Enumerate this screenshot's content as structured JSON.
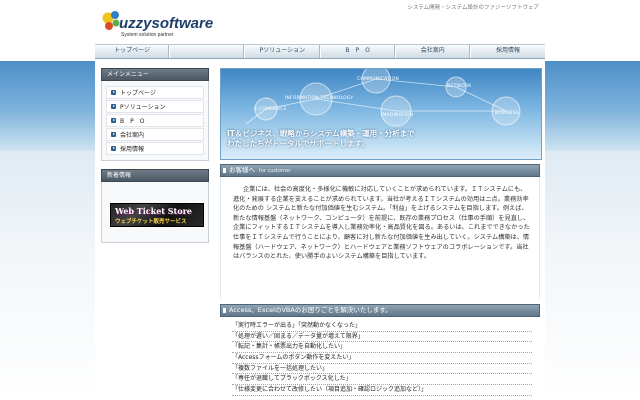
{
  "header": {
    "logo_text": "fuzzysoftware",
    "logo_sub": "System solution partner",
    "tagline": "システム開発・システム設計のファジーソフトウェア"
  },
  "nav": {
    "items": [
      {
        "label": "トップページ"
      },
      {
        "label": ""
      },
      {
        "label": "Pソリューション"
      },
      {
        "label": "B　P　O"
      },
      {
        "label": "会社案内"
      },
      {
        "label": "採用情報"
      }
    ]
  },
  "sidebar": {
    "menu_title": "メインメニュー",
    "menu_items": [
      {
        "label": "トップページ"
      },
      {
        "label": "Pソリューション"
      },
      {
        "label": "B　P　O"
      },
      {
        "label": "会社案内"
      },
      {
        "label": "採用情報"
      }
    ],
    "news_title": "新着情報",
    "banner_title": "Web Ticket Store",
    "banner_sub": "ウェブチケット販売サービス"
  },
  "hero": {
    "bubbles": [
      "COMMUNICATION",
      "INFORMATION TECHNOLOGY",
      "NETWORK",
      "E-COMMERCE",
      "IMAGINATION",
      "BUSINESS"
    ],
    "line1": "IT＆ビジネス、戦略からシステム構築・運用・分析まで",
    "line2": "わたしたちがトータルでサポートします。"
  },
  "customer": {
    "title": "お客様へ",
    "subtitle": "for customer",
    "body": "企業には、社会の高度化・多様化に機敏に対応していくことが求められています。ＩＴシステムにも、進化・発展する企業を支えることが求められています。当社が考えるＩＴシステムの効用はニ点。業務効率化のための システムと新たな付加価値を生むシステム。「利益」を上げるシステムを目指します。例えば、新たな情報基盤（ネットワーク、コンピュータ）を前提に、既存の業務プロセス（仕事の手順）を見直し、企業にフィットするＩＴシステムを導入し業務効率化・高品質化を図る。あるいは、これまでできなかった仕事をＩＴシステムで行うことにより、顧客に対し新たな付加価値を生み出していく。システム構築は、情報基盤（ハードウェア、ネットワーク）とハードウェアと業務ソフトウェアのコラボレーションです。当社はバランスのとれた、使い勝手のよいシステム構築を目指しています。"
  },
  "access": {
    "title": "Access、ExcelのVBAのお困りごとを解決いたします。",
    "items": [
      "「実行時エラーが出る」「突然動かなくなった」",
      "「処理が遅い／固まる／データ量が増えて限界」",
      "「転記・集計・帳票出力を自動化したい」",
      "「Accessフォームのボタン動作を変えたい」",
      "「複数ファイルを一括処理したい」",
      "「専任が退職してブラックボックス化した」",
      "「仕様変更に合わせて改修したい（項目追加・確認ロジック追加など）」"
    ]
  },
  "colors": {
    "band_top": "#4d8fc8",
    "nav_text": "#2f4b62",
    "section_head": "#61788a"
  }
}
